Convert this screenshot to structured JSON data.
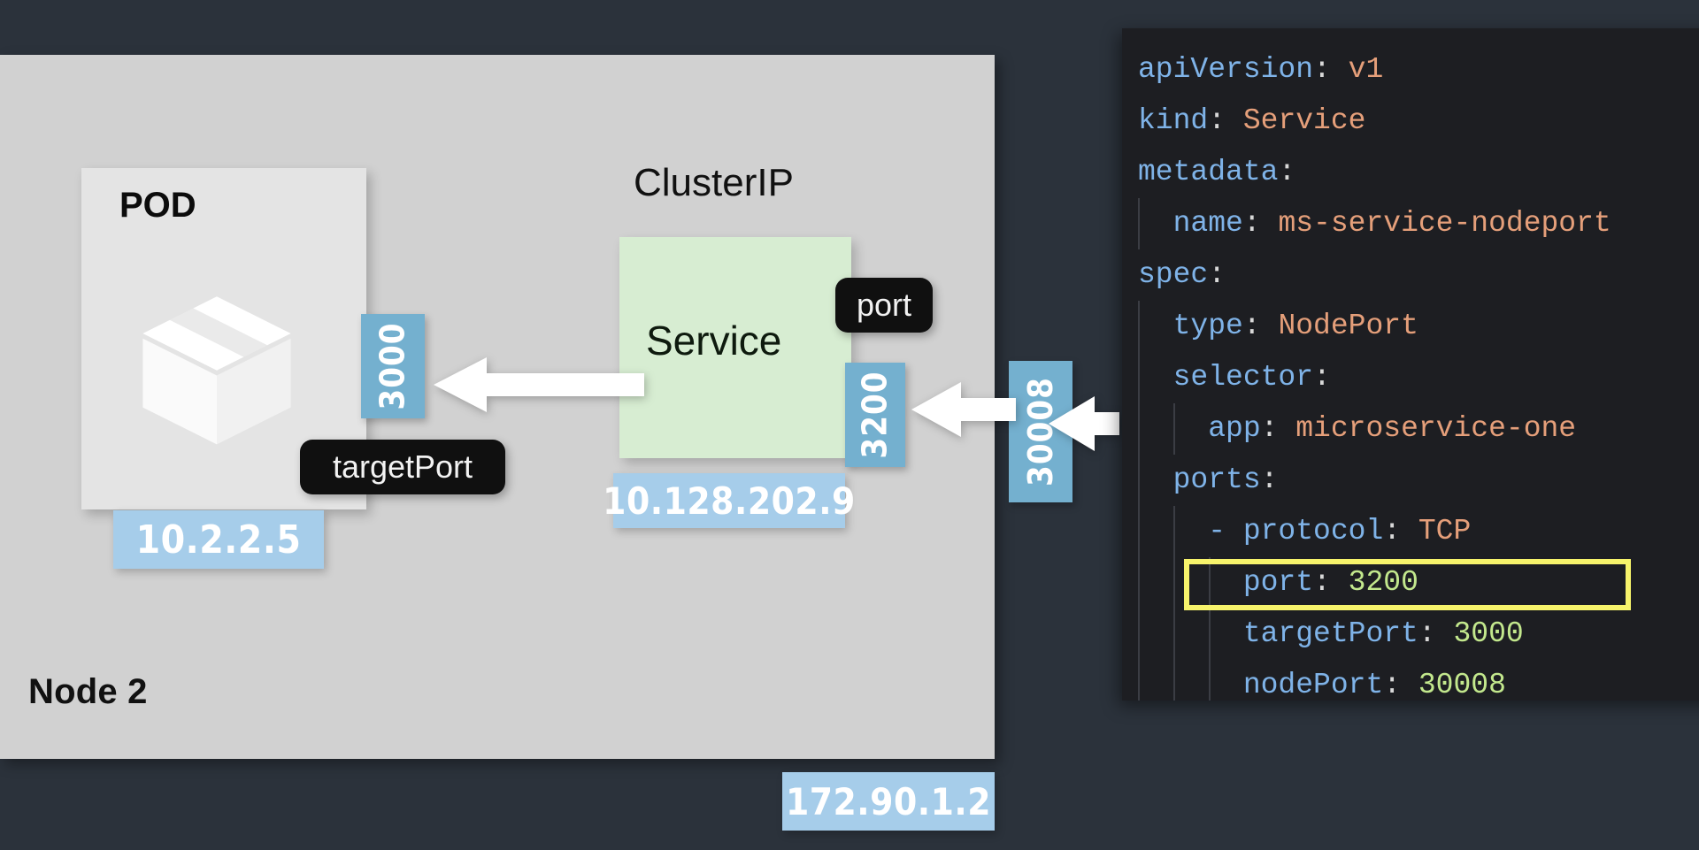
{
  "background_color": "#2b323b",
  "diagram": {
    "node": {
      "label": "Node 2",
      "ip": "172.90.1.2",
      "fill_color": "#d1d1d1"
    },
    "pod": {
      "label": "POD",
      "ip": "10.2.2.5",
      "icon": "package-box-icon",
      "fill_color": "#e4e4e4"
    },
    "service": {
      "label": "Service",
      "heading": "ClusterIP",
      "ip": "10.128.202.9",
      "fill_color": "#d7edd2"
    },
    "ports": {
      "target_port": "3000",
      "service_port": "3200",
      "node_port": "30008",
      "chip_color": "#74b0cf"
    },
    "tags": {
      "target_port_tag": "targetPort",
      "port_tag": "port"
    },
    "ip_chip_color": "#a6cdea"
  },
  "code_panel": {
    "background_color": "#1d1e22",
    "highlight_color": "#f7f36b",
    "highlighted_line_index": 10,
    "lines": [
      {
        "indent": 0,
        "tokens": [
          {
            "t": "apiVersion",
            "c": "k"
          },
          {
            "t": ":",
            "c": "p"
          },
          {
            "t": " v1",
            "c": "v"
          }
        ]
      },
      {
        "indent": 0,
        "tokens": [
          {
            "t": "kind",
            "c": "k"
          },
          {
            "t": ":",
            "c": "p"
          },
          {
            "t": " Service",
            "c": "v"
          }
        ]
      },
      {
        "indent": 0,
        "tokens": [
          {
            "t": "metadata",
            "c": "k"
          },
          {
            "t": ":",
            "c": "p"
          }
        ]
      },
      {
        "indent": 1,
        "tokens": [
          {
            "t": "name",
            "c": "k"
          },
          {
            "t": ":",
            "c": "p"
          },
          {
            "t": " ms-service-nodeport",
            "c": "v"
          }
        ]
      },
      {
        "indent": 0,
        "tokens": [
          {
            "t": "spec",
            "c": "k"
          },
          {
            "t": ":",
            "c": "p"
          }
        ]
      },
      {
        "indent": 1,
        "tokens": [
          {
            "t": "type",
            "c": "k"
          },
          {
            "t": ":",
            "c": "p"
          },
          {
            "t": " NodePort",
            "c": "v"
          }
        ]
      },
      {
        "indent": 1,
        "tokens": [
          {
            "t": "selector",
            "c": "k"
          },
          {
            "t": ":",
            "c": "p"
          }
        ]
      },
      {
        "indent": 2,
        "tokens": [
          {
            "t": "app",
            "c": "k"
          },
          {
            "t": ":",
            "c": "p"
          },
          {
            "t": " microservice-one",
            "c": "v"
          }
        ]
      },
      {
        "indent": 1,
        "tokens": [
          {
            "t": "ports",
            "c": "k"
          },
          {
            "t": ":",
            "c": "p"
          }
        ]
      },
      {
        "indent": 2,
        "tokens": [
          {
            "t": "- ",
            "c": "d"
          },
          {
            "t": "protocol",
            "c": "k"
          },
          {
            "t": ":",
            "c": "p"
          },
          {
            "t": " TCP",
            "c": "v"
          }
        ]
      },
      {
        "indent": 3,
        "tokens": [
          {
            "t": "port",
            "c": "k"
          },
          {
            "t": ":",
            "c": "p"
          },
          {
            "t": " 3200",
            "c": "n"
          }
        ]
      },
      {
        "indent": 3,
        "tokens": [
          {
            "t": "targetPort",
            "c": "k"
          },
          {
            "t": ":",
            "c": "p"
          },
          {
            "t": " 3000",
            "c": "n"
          }
        ]
      },
      {
        "indent": 3,
        "tokens": [
          {
            "t": "nodePort",
            "c": "k"
          },
          {
            "t": ":",
            "c": "p"
          },
          {
            "t": " 30008",
            "c": "n"
          }
        ]
      }
    ]
  }
}
